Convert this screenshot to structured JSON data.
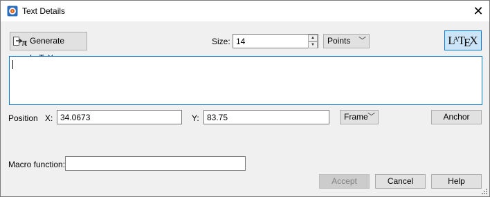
{
  "window": {
    "title": "Text Details"
  },
  "toolbar": {
    "generate_label": "Generate LaTeX",
    "size_label": "Size:",
    "size_value": "14",
    "units_value": "Points",
    "latex_label_L": "L",
    "latex_label_A": "A",
    "latex_label_T": "T",
    "latex_label_E": "E",
    "latex_label_X": "X"
  },
  "editor": {
    "value": ""
  },
  "position": {
    "label": "Position",
    "x_label": "X:",
    "x_value": "34.0673",
    "y_label": "Y:",
    "y_value": "83.75",
    "frame_value": "Frame",
    "anchor_label": "Anchor"
  },
  "macro": {
    "label": "Macro function:",
    "value": ""
  },
  "footer": {
    "accept_label": "Accept",
    "cancel_label": "Cancel",
    "help_label": "Help"
  },
  "colors": {
    "accent": "#0078d7",
    "latex_button_bg": "#cce4f7",
    "dialog_bg": "#f0f0f0"
  }
}
